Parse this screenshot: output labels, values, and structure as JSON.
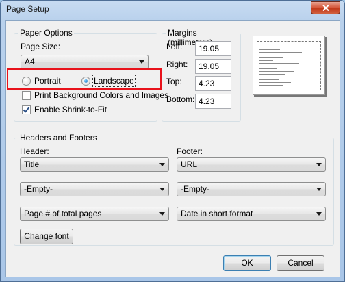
{
  "window": {
    "title": "Page Setup"
  },
  "paper_options": {
    "legend": "Paper Options",
    "page_size_label": "Page Size:",
    "page_size_value": "A4",
    "portrait_label": "Portrait",
    "landscape_label": "Landscape",
    "orientation_selected": "Landscape",
    "print_background_label": "Print Background Colors and Images",
    "print_background_checked": false,
    "shrink_label": "Enable Shrink-to-Fit",
    "shrink_checked": true
  },
  "margins": {
    "legend": "Margins (millimeters)",
    "left_label": "Left:",
    "left_value": "19.05",
    "right_label": "Right:",
    "right_value": "19.05",
    "top_label": "Top:",
    "top_value": "4.23",
    "bottom_label": "Bottom:",
    "bottom_value": "4.23"
  },
  "headers_footers": {
    "legend": "Headers and Footers",
    "header_label": "Header:",
    "footer_label": "Footer:",
    "header_values": [
      "Title",
      "-Empty-",
      "Page # of total pages"
    ],
    "footer_values": [
      "URL",
      "-Empty-",
      "Date in short format"
    ],
    "change_font_label": "Change font"
  },
  "buttons": {
    "ok": "OK",
    "cancel": "Cancel"
  },
  "colors": {
    "highlight": "#e8121b",
    "close_button": "#c23a1b"
  },
  "icons": {
    "close": "close-icon",
    "dropdown": "chevron-down-icon",
    "checkmark": "checkmark-icon"
  }
}
